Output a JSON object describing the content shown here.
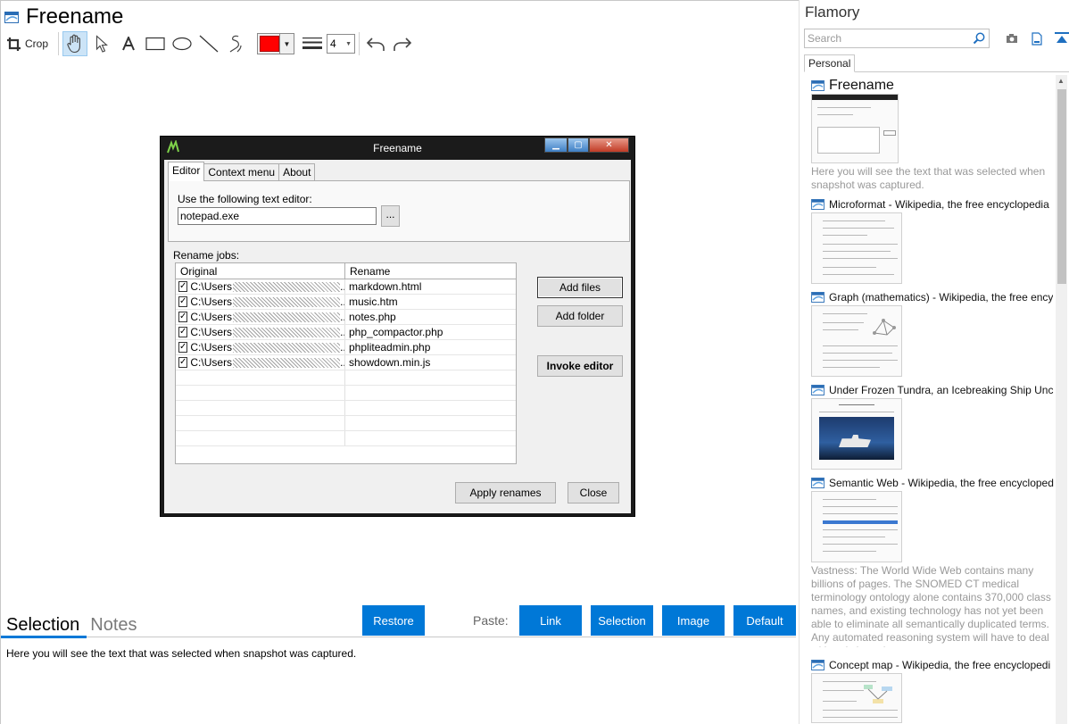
{
  "main": {
    "title": "Freename",
    "toolbar": {
      "crop_label": "Crop",
      "line_width_value": "4",
      "color": "#ff0000"
    }
  },
  "screenshot_window": {
    "title": "Freename",
    "tabs": [
      "Editor",
      "Context menu",
      "About"
    ],
    "editor_label": "Use the following text editor:",
    "editor_value": "notepad.exe",
    "browse_label": "...",
    "jobs_label": "Rename jobs:",
    "columns": [
      "Original",
      "Rename"
    ],
    "rows": [
      {
        "original": "C:\\Users",
        "tail": "...",
        "rename": "markdown.html"
      },
      {
        "original": "C:\\Users",
        "tail": "...",
        "rename": "music.htm"
      },
      {
        "original": "C:\\Users",
        "tail": "...",
        "rename": "notes.php"
      },
      {
        "original": "C:\\Users",
        "tail": "...",
        "rename": "php_compactor.php"
      },
      {
        "original": "C:\\Users",
        "tail": "...",
        "rename": "phpliteadmin.php"
      },
      {
        "original": "C:\\Users",
        "tail": "...",
        "rename": "showdown.min.js"
      }
    ],
    "buttons": {
      "add_files": "Add files",
      "add_folder": "Add folder",
      "invoke_editor": "Invoke editor",
      "apply_renames": "Apply renames",
      "close": "Close"
    }
  },
  "bottom": {
    "tabs": [
      "Selection",
      "Notes"
    ],
    "restore": "Restore",
    "paste_label": "Paste:",
    "paste_buttons": [
      "Link",
      "Selection",
      "Image",
      "Default"
    ],
    "selection_text": "Here you will see the text that was selected when snapshot was captured."
  },
  "sidebar": {
    "title": "Flamory",
    "search_placeholder": "Search",
    "tab": "Personal",
    "snapshots": [
      {
        "title": "Freename",
        "desc": "Here you will see the text that was selected when snapshot was captured."
      },
      {
        "title": "Microformat - Wikipedia, the free encyclopedia",
        "desc": ""
      },
      {
        "title": "Graph (mathematics) - Wikipedia, the free ency",
        "desc": ""
      },
      {
        "title": "Under Frozen Tundra, an Icebreaking Ship Unco",
        "desc": ""
      },
      {
        "title": "Semantic Web - Wikipedia, the free encycloped",
        "desc": "Vastness: The World Wide Web contains many billions of pages. The SNOMED CT medical terminology ontology alone contains 370,000 class names, and existing technology has not yet been able to eliminate all semantically duplicated terms. Any automated reasoning system will have to deal with truly huge inputs."
      },
      {
        "title": "Concept map - Wikipedia, the free encyclopedi",
        "desc": ""
      }
    ]
  }
}
